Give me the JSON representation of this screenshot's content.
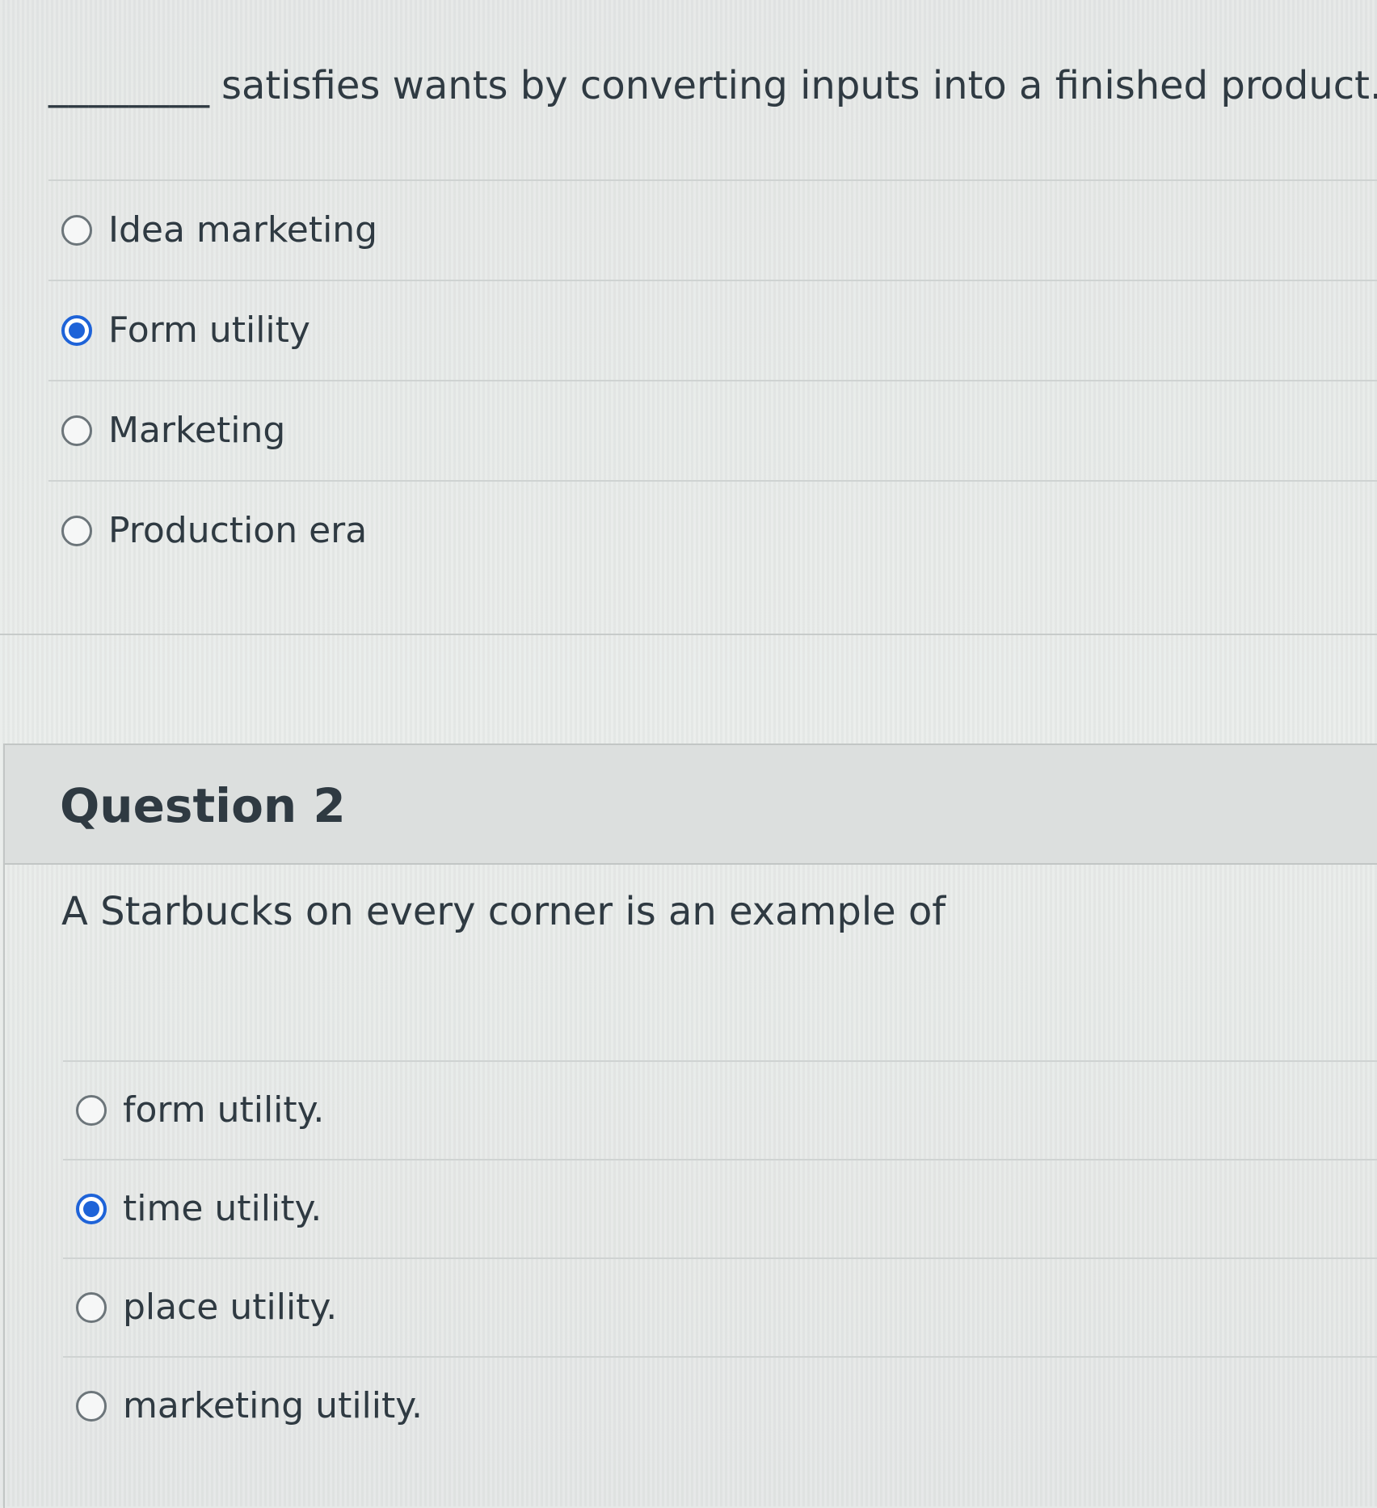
{
  "question1": {
    "blank": "________",
    "prompt": "satisfies wants by converting inputs into a finished product.",
    "answers": [
      {
        "label": "Idea marketing",
        "selected": false
      },
      {
        "label": "Form utility",
        "selected": true
      },
      {
        "label": "Marketing",
        "selected": false
      },
      {
        "label": "Production era",
        "selected": false
      }
    ]
  },
  "question2": {
    "title": "Question 2",
    "prompt": "A Starbucks on every corner is an example of",
    "answers": [
      {
        "label": "form utility.",
        "selected": false
      },
      {
        "label": "time utility.",
        "selected": true
      },
      {
        "label": "place utility.",
        "selected": false
      },
      {
        "label": "marketing utility.",
        "selected": false
      }
    ]
  },
  "colors": {
    "selected_radio": "#1e63d8",
    "text": "#2f3a42",
    "header_bg": "#dcdfde"
  }
}
